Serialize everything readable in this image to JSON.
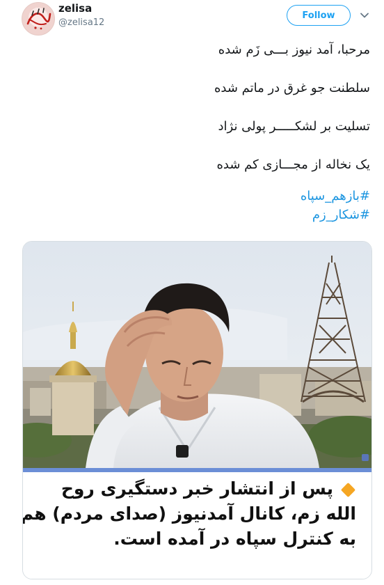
{
  "user": {
    "display_name": "zelisa",
    "handle": "@zelisa12",
    "avatar_icon": "avatar-calligraphy-logo",
    "avatar_lettering": "آن شنیم"
  },
  "actions": {
    "follow_label": "Follow",
    "menu_icon": "chevron-down-icon"
  },
  "tweet": {
    "lines": [
      "مرحبا، آمد نیوز بـــی زَم شده",
      "سلطنت جو غرق در ماتم شده",
      "تسلیت بر لشکـــــر پولی نژاد",
      "یک نخاله از مجـــازی کم شده"
    ],
    "hashtags": [
      "#بازهم_سپاه",
      "#شکار_زم"
    ]
  },
  "media": {
    "caption_lines": [
      "پس از انتشار خبر دستگیری روح",
      "الله زم، کانال آمدنیوز (صدای مردم) هم",
      "به کنترل سپاه در آمده است."
    ],
    "caption_icon": "orange-diamond-icon"
  },
  "colors": {
    "accent": "#1da1f2",
    "hashtag": "#1b95e0",
    "caption_diamond": "#f5a623",
    "photo_strip": "#6b8ed6"
  }
}
